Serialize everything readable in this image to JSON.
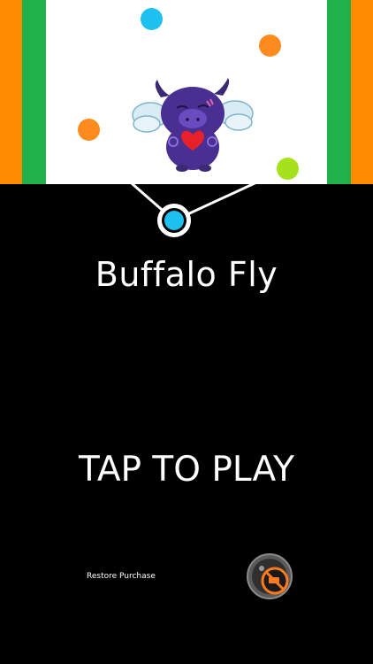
{
  "game": {
    "title": "Buffalo Fly",
    "tap_to_play": "TAP TO PLAY",
    "restore_purchase": "Restore Purchase",
    "no_ads_icon": "no-ads-icon",
    "mascot_icon": "winged-purple-buffalo-icon"
  },
  "colors": {
    "background": "#000000",
    "playfield": "#ffffff",
    "stripe_orange": "#ff8c00",
    "stripe_green": "#21b14b",
    "dot_cyan": "#1ec0ef",
    "dot_orange": "#ff8a1e",
    "dot_lime": "#a6e21c",
    "rope": "#ffffff"
  }
}
